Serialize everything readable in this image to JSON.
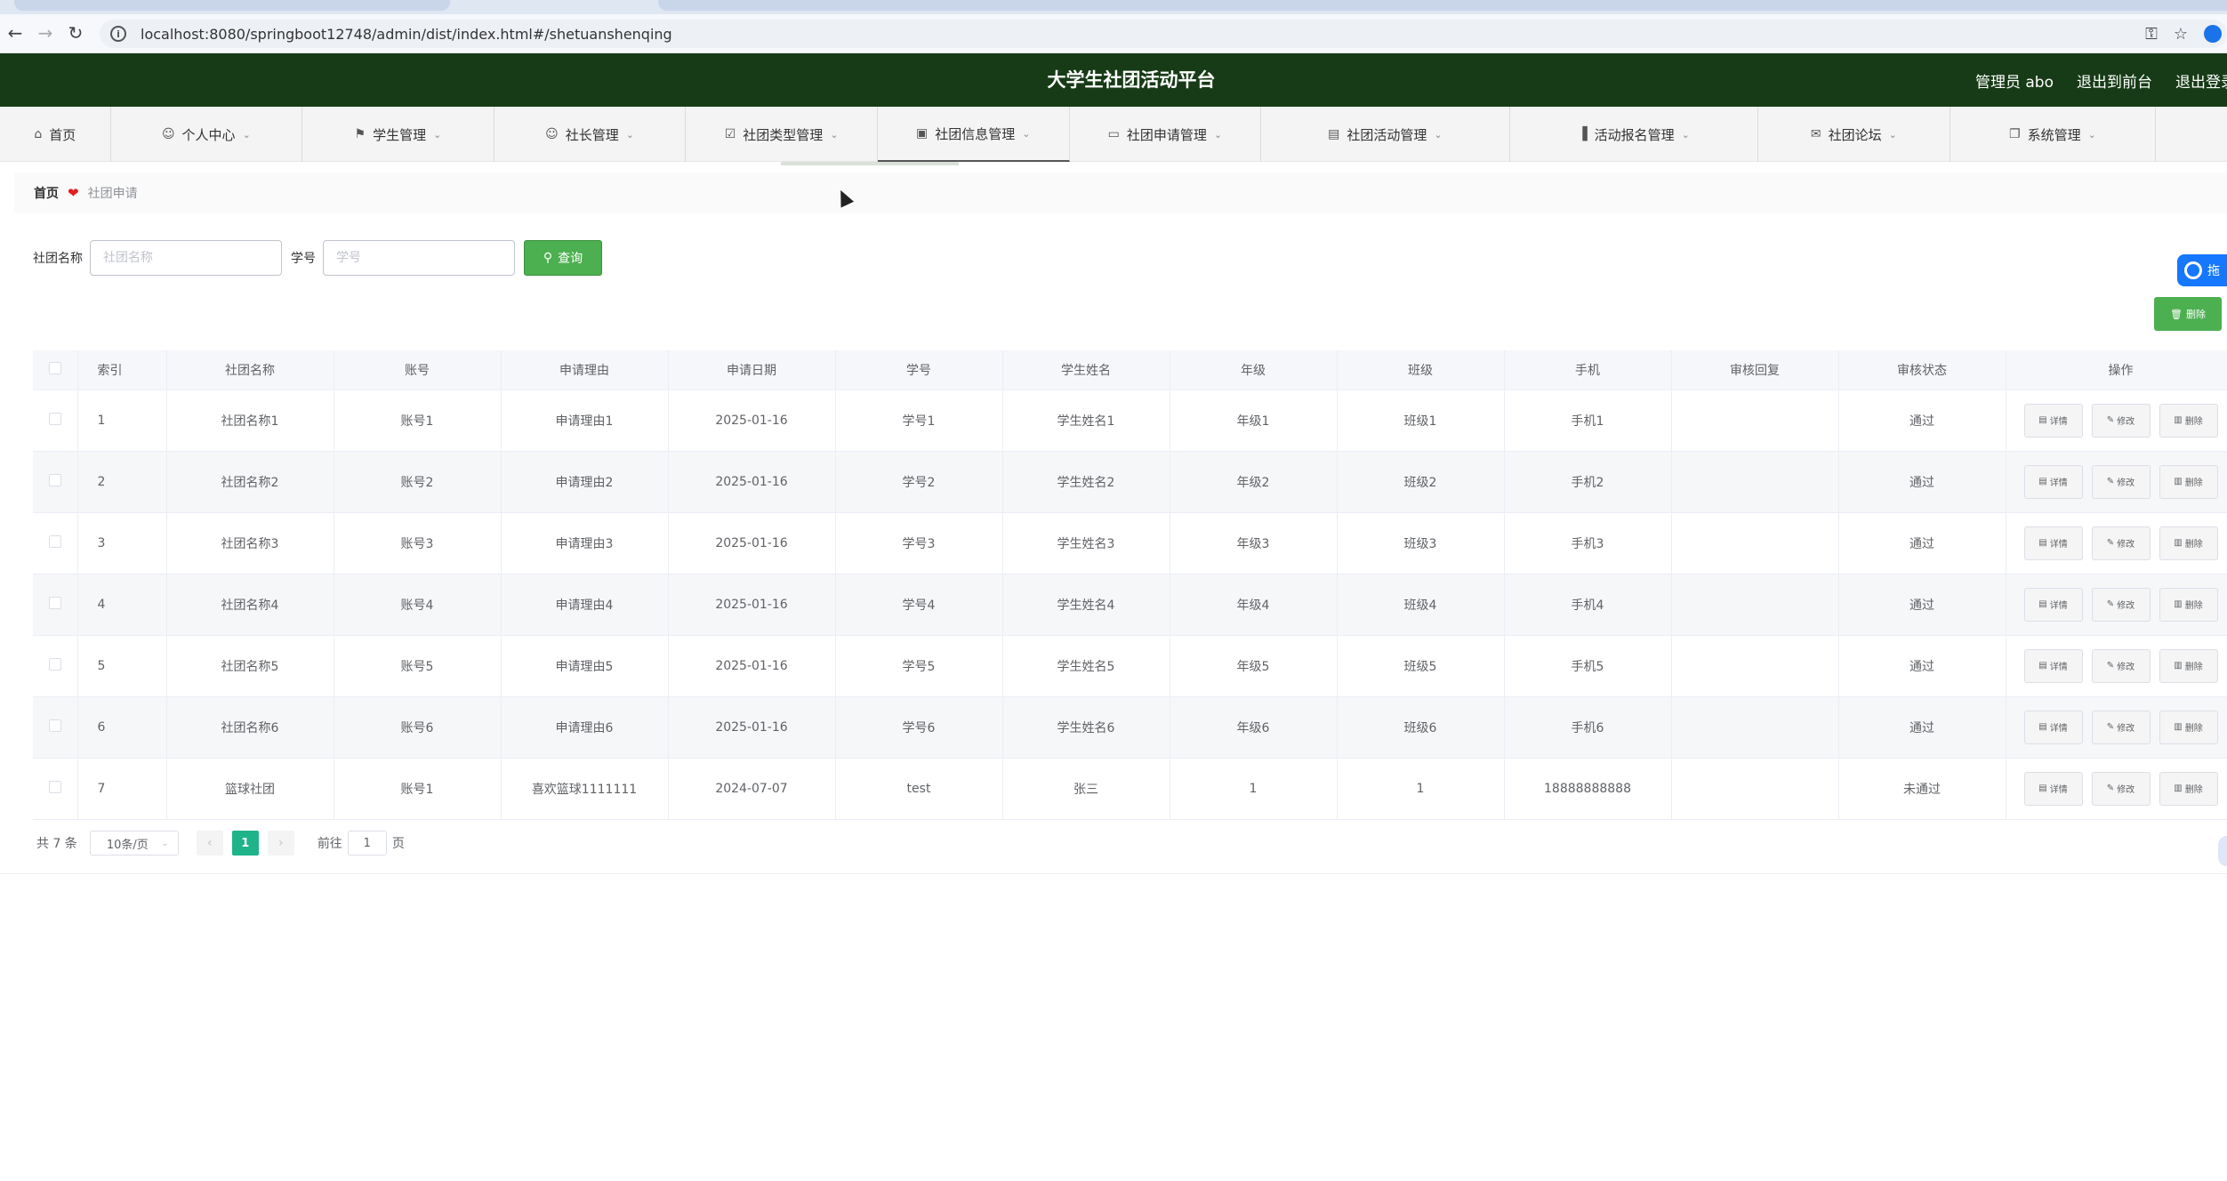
{
  "browser": {
    "url": "localhost:8080/springboot12748/admin/dist/index.html#/shetuanshenqing"
  },
  "header": {
    "title": "大学生社团活动平台",
    "admin_label": "管理员 abo",
    "back_front": "退出到前台",
    "logout": "退出登录"
  },
  "menu": [
    {
      "label": "首页",
      "icon": "home-icon",
      "has_dropdown": false
    },
    {
      "label": "个人中心",
      "icon": "user-icon",
      "has_dropdown": true
    },
    {
      "label": "学生管理",
      "icon": "flag-icon",
      "has_dropdown": true
    },
    {
      "label": "社长管理",
      "icon": "user-icon",
      "has_dropdown": true
    },
    {
      "label": "社团类型管理",
      "icon": "checkbox-icon",
      "has_dropdown": true
    },
    {
      "label": "社团信息管理",
      "icon": "briefcase-icon",
      "has_dropdown": true
    },
    {
      "label": "社团申请管理",
      "icon": "ticket-icon",
      "has_dropdown": true
    },
    {
      "label": "社团活动管理",
      "icon": "comment-icon",
      "has_dropdown": true
    },
    {
      "label": "活动报名管理",
      "icon": "bar-chart-icon",
      "has_dropdown": true
    },
    {
      "label": "社团论坛",
      "icon": "mail-icon",
      "has_dropdown": true
    },
    {
      "label": "系统管理",
      "icon": "copy-icon",
      "has_dropdown": true
    }
  ],
  "breadcrumb": {
    "home": "首页",
    "current": "社团申请"
  },
  "search": {
    "club_label": "社团名称",
    "club_placeholder": "社团名称",
    "student_label": "学号",
    "student_placeholder": "学号",
    "query_button": "查询"
  },
  "float_widget": {
    "text": "拖"
  },
  "toolbar": {
    "delete_button": "删除"
  },
  "table": {
    "headers": [
      "索引",
      "社团名称",
      "账号",
      "申请理由",
      "申请日期",
      "学号",
      "学生姓名",
      "年级",
      "班级",
      "手机",
      "审核回复",
      "审核状态",
      "操作"
    ],
    "actions": {
      "detail": "详情",
      "edit": "修改",
      "delete": "删除"
    },
    "rows": [
      {
        "idx": "1",
        "club": "社团名称1",
        "account": "账号1",
        "reason": "申请理由1",
        "date": "2025-01-16",
        "student_no": "学号1",
        "name": "学生姓名1",
        "grade": "年级1",
        "class": "班级1",
        "phone": "手机1",
        "reply": "",
        "status": "通过"
      },
      {
        "idx": "2",
        "club": "社团名称2",
        "account": "账号2",
        "reason": "申请理由2",
        "date": "2025-01-16",
        "student_no": "学号2",
        "name": "学生姓名2",
        "grade": "年级2",
        "class": "班级2",
        "phone": "手机2",
        "reply": "",
        "status": "通过"
      },
      {
        "idx": "3",
        "club": "社团名称3",
        "account": "账号3",
        "reason": "申请理由3",
        "date": "2025-01-16",
        "student_no": "学号3",
        "name": "学生姓名3",
        "grade": "年级3",
        "class": "班级3",
        "phone": "手机3",
        "reply": "",
        "status": "通过"
      },
      {
        "idx": "4",
        "club": "社团名称4",
        "account": "账号4",
        "reason": "申请理由4",
        "date": "2025-01-16",
        "student_no": "学号4",
        "name": "学生姓名4",
        "grade": "年级4",
        "class": "班级4",
        "phone": "手机4",
        "reply": "",
        "status": "通过"
      },
      {
        "idx": "5",
        "club": "社团名称5",
        "account": "账号5",
        "reason": "申请理由5",
        "date": "2025-01-16",
        "student_no": "学号5",
        "name": "学生姓名5",
        "grade": "年级5",
        "class": "班级5",
        "phone": "手机5",
        "reply": "",
        "status": "通过"
      },
      {
        "idx": "6",
        "club": "社团名称6",
        "account": "账号6",
        "reason": "申请理由6",
        "date": "2025-01-16",
        "student_no": "学号6",
        "name": "学生姓名6",
        "grade": "年级6",
        "class": "班级6",
        "phone": "手机6",
        "reply": "",
        "status": "通过"
      },
      {
        "idx": "7",
        "club": "篮球社团",
        "account": "账号1",
        "reason": "喜欢篮球1111111",
        "date": "2024-07-07",
        "student_no": "test",
        "name": "张三",
        "grade": "1",
        "class": "1",
        "phone": "18888888888",
        "reply": "",
        "status": "未通过"
      }
    ]
  },
  "pagination": {
    "total": "共 7 条",
    "page_size": "10条/页",
    "current_page": "1",
    "goto_label": "前往",
    "goto_value": "1",
    "page_suffix": "页"
  }
}
